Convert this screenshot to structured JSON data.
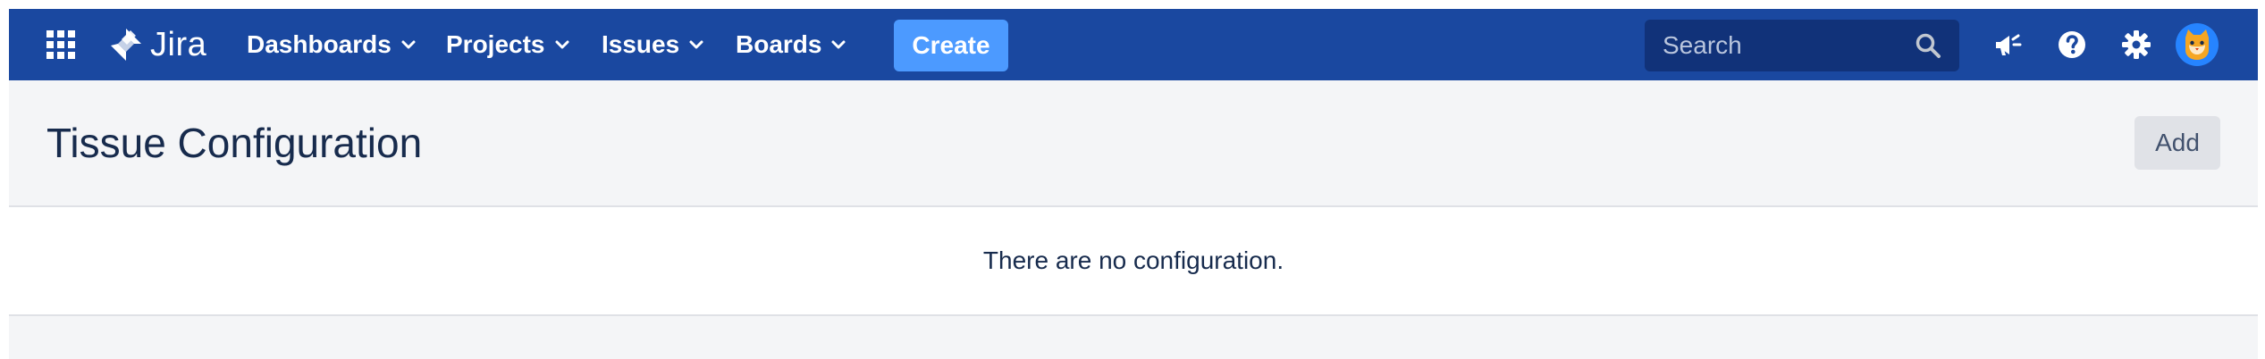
{
  "topnav": {
    "logo_text": "Jira",
    "menu": [
      {
        "label": "Dashboards"
      },
      {
        "label": "Projects"
      },
      {
        "label": "Issues"
      },
      {
        "label": "Boards"
      }
    ],
    "create_label": "Create",
    "search": {
      "placeholder": "Search",
      "value": ""
    },
    "icons": [
      "app-switcher-icon",
      "jira-logo-icon",
      "chevron-down-icon",
      "search-icon",
      "megaphone-icon",
      "help-icon",
      "gear-icon",
      "cat-avatar-icon"
    ]
  },
  "page": {
    "title": "Tissue Configuration",
    "add_label": "Add",
    "empty_message": "There are no configuration."
  },
  "colors": {
    "nav_background": "#1a48a0",
    "create_button": "#4c9aff",
    "search_background": "#113279",
    "page_background": "#f4f5f7",
    "title_text": "#172b4d",
    "add_button": "#e0e2e7",
    "avatar_background": "#2684ff"
  }
}
